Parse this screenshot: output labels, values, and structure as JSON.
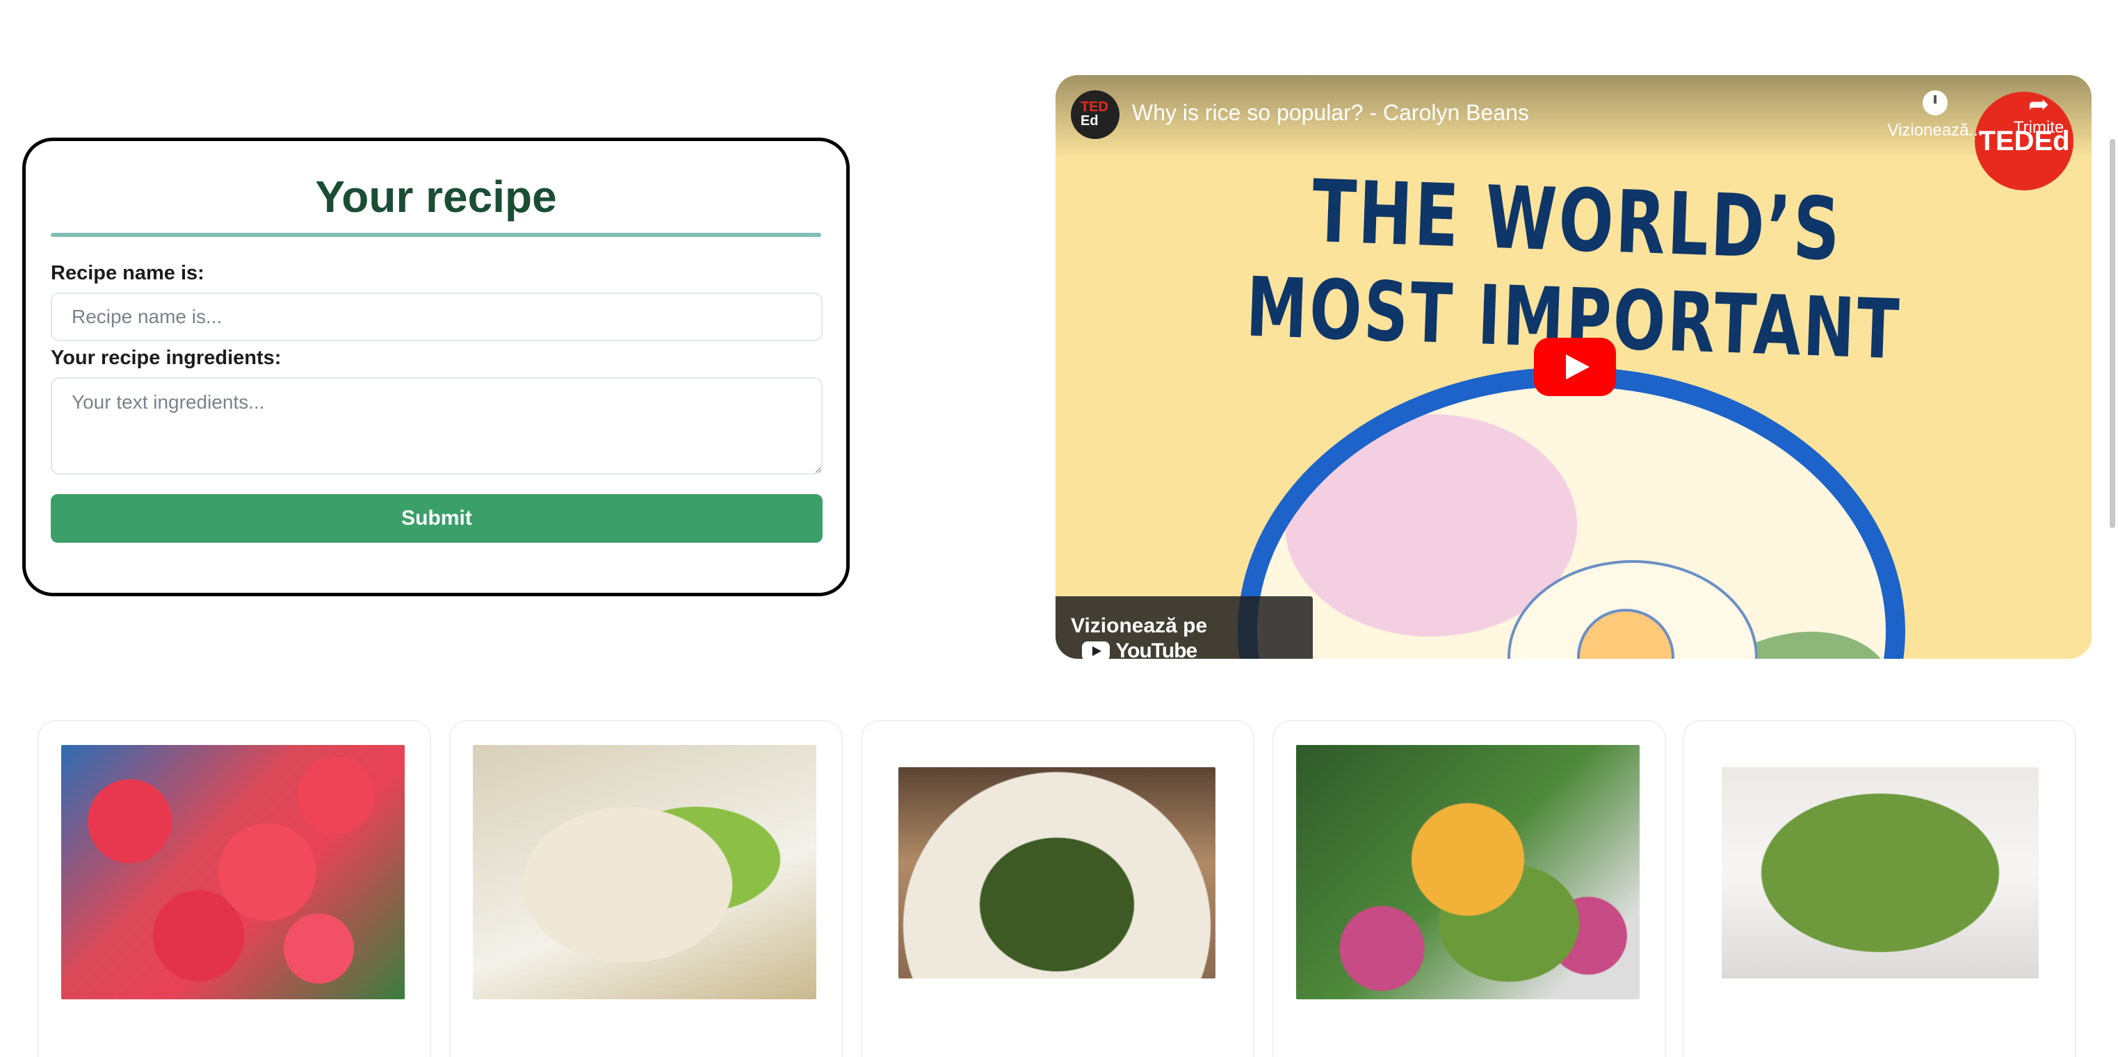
{
  "recipe_form": {
    "title": "Your recipe",
    "name_label": "Recipe name is:",
    "name_placeholder": "Recipe name is...",
    "name_value": "",
    "ingredients_label": "Your recipe ingredients:",
    "ingredients_placeholder": "Your text ingredients...",
    "ingredients_value": "",
    "submit_label": "Submit"
  },
  "video": {
    "title": "Why is rice so popular? - Carolyn Beans",
    "channel_badge_top": "TED",
    "channel_badge_bottom": "Ed",
    "headline_line1": "THE WORLD’S",
    "headline_line2": "MOST IMPORTANT FOOD",
    "watch_later_label": "Vizionează...",
    "share_label": "Trimite",
    "ted_logo_text": "TEDEd",
    "watch_on_label": "Vizionează pe",
    "youtube_label": "YouTube"
  },
  "food_cards": [
    {
      "image": "watermelon-feta-salad"
    },
    {
      "image": "apple-walnut-salad"
    },
    {
      "image": "pear-greens-plate"
    },
    {
      "image": "mango-avocado-radish-salad"
    },
    {
      "image": "arugula-parmesan-salad"
    }
  ],
  "colors": {
    "title_green": "#1b4d35",
    "divider_teal": "#7fbfb4",
    "submit_green": "#3a9f69",
    "youtube_red": "#ff0000",
    "ted_red": "#e62b1e"
  }
}
